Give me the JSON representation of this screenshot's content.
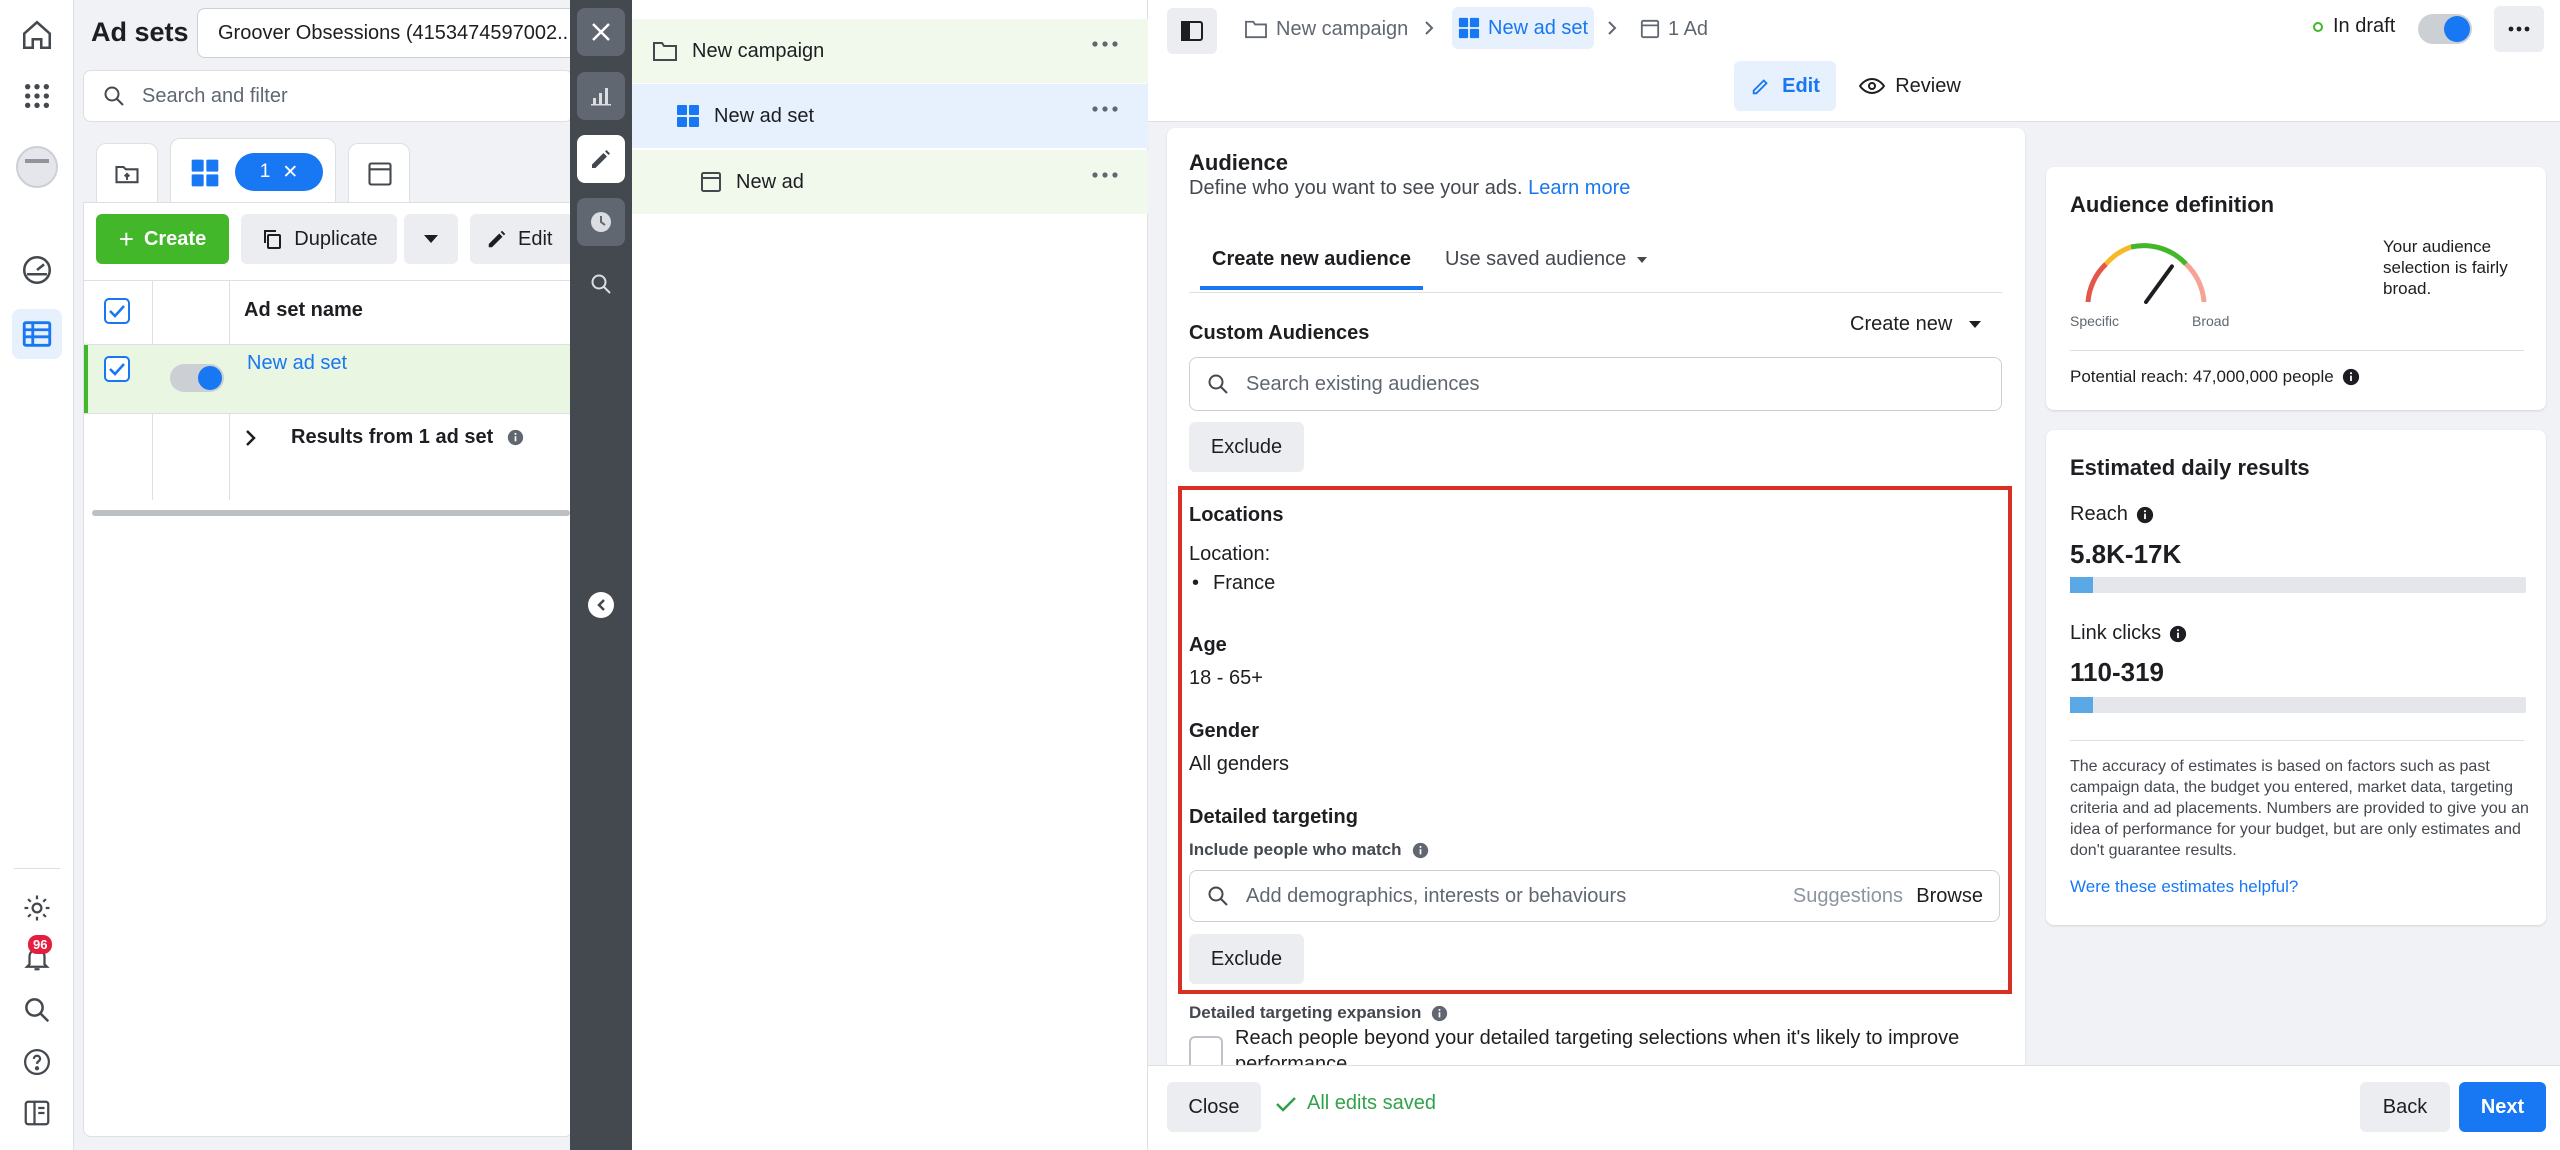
{
  "sidebar": {
    "notifications_count": "96"
  },
  "adsets": {
    "title": "Ad sets",
    "account": "Groover Obsessions (4153474597002...",
    "search_placeholder": "Search and filter",
    "selected_count": "1",
    "create_label": "Create",
    "duplicate_label": "Duplicate",
    "edit_label": "Edit",
    "column_header": "Ad set name",
    "row_name": "New ad set",
    "results_label": "Results from 1 ad set"
  },
  "tree": {
    "campaign": "New campaign",
    "adset": "New ad set",
    "ad": "New ad"
  },
  "breadcrumb": {
    "campaign": "New campaign",
    "adset": "New ad set",
    "ad": "1 Ad",
    "status": "In draft"
  },
  "mode_tabs": {
    "edit": "Edit",
    "review": "Review"
  },
  "audience": {
    "title": "Audience",
    "description": "Define who you want to see your ads.",
    "learn_more": "Learn more",
    "tab_create": "Create new audience",
    "tab_saved": "Use saved audience",
    "custom_audiences_label": "Custom Audiences",
    "create_new": "Create new",
    "search_placeholder": "Search existing audiences",
    "exclude": "Exclude",
    "locations_label": "Locations",
    "location_prefix": "Location:",
    "location_value": "France",
    "age_label": "Age",
    "age_value": "18 - 65+",
    "gender_label": "Gender",
    "gender_value": "All genders",
    "detailed_label": "Detailed targeting",
    "include_label": "Include people who match",
    "detailed_placeholder": "Add demographics, interests or behaviours",
    "suggestions": "Suggestions",
    "browse": "Browse",
    "exclude2": "Exclude",
    "expansion_label": "Detailed targeting expansion",
    "expansion_text": "Reach people beyond your detailed targeting selections when it's likely to improve performance."
  },
  "audience_definition": {
    "title": "Audience definition",
    "gauge_left": "Specific",
    "gauge_right": "Broad",
    "summary": "Your audience selection is fairly broad.",
    "potential_reach": "Potential reach: 47,000,000 people",
    "gauge_level_pct": 70
  },
  "estimates": {
    "title": "Estimated daily results",
    "reach_label": "Reach",
    "reach_value": "5.8K-17K",
    "reach_fill_pct": 5,
    "clicks_label": "Link clicks",
    "clicks_value": "110-319",
    "clicks_fill_pct": 5,
    "disclaimer": "The accuracy of estimates is based on factors such as past campaign data, the budget you entered, market data, targeting criteria and ad placements. Numbers are provided to give you an idea of performance for your budget, but are only estimates and don't guarantee results.",
    "feedback_link": "Were these estimates helpful?"
  },
  "footer": {
    "close": "Close",
    "saved_status": "All edits saved",
    "back": "Back",
    "next": "Next"
  },
  "colors": {
    "accent": "#1877f2",
    "success": "#42b72a",
    "highlight_border": "#d93025"
  }
}
